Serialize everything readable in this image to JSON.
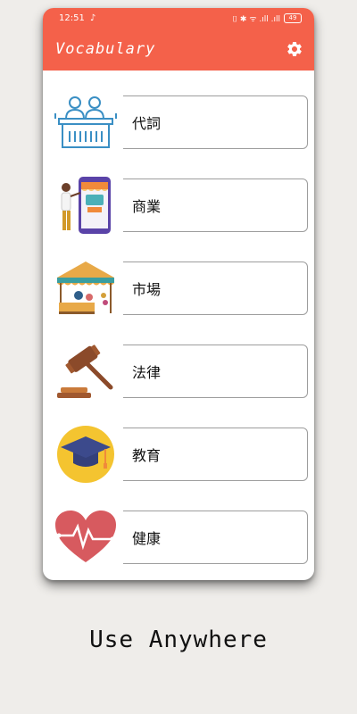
{
  "status": {
    "time": "12:51",
    "music_icon": "music-note-icon",
    "indicators": "⌷ ✱ ᯤ .ıll .ıll",
    "battery": "49"
  },
  "appbar": {
    "title": "Vocabulary",
    "settings_icon": "gear-icon"
  },
  "categories": [
    {
      "label": "代詞",
      "icon": "people-at-desk-icon"
    },
    {
      "label": "商業",
      "icon": "mobile-shop-icon"
    },
    {
      "label": "市場",
      "icon": "market-stall-icon"
    },
    {
      "label": "法律",
      "icon": "gavel-icon"
    },
    {
      "label": "教育",
      "icon": "graduation-cap-icon"
    },
    {
      "label": "健康",
      "icon": "heartbeat-icon"
    }
  ],
  "tagline": "Use Anywhere",
  "colors": {
    "accent": "#f4614a",
    "background": "#efedea"
  }
}
